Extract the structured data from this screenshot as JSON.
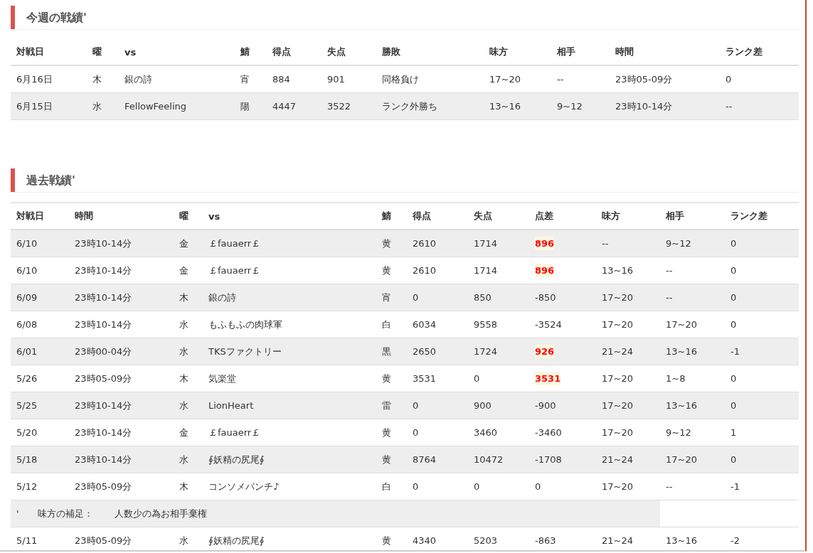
{
  "sections": [
    {
      "title": "今週の戦績'",
      "columns": [
        "対戦日",
        "曜",
        "vs",
        "鯖",
        "得点",
        "失点",
        "勝敗",
        "味方",
        "相手",
        "時間",
        "ランク差"
      ],
      "rows": [
        {
          "kind": "match",
          "cells": [
            "6月16日",
            "木",
            "銀の詩",
            "宵",
            "884",
            "901",
            "同格負け",
            "17~20",
            "--",
            "23時05-09分",
            "0"
          ]
        },
        {
          "kind": "match",
          "cells": [
            "6月15日",
            "水",
            "FellowFeeling",
            "陽",
            "4447",
            "3522",
            "ランク外勝ち",
            "13~16",
            "9~12",
            "23時10-14分",
            "--"
          ]
        }
      ]
    },
    {
      "title": "過去戦績'",
      "columns": [
        "対戦日",
        "時間",
        "曜",
        "vs",
        "鯖",
        "得点",
        "失点",
        "点差",
        "味方",
        "相手",
        "ランク差"
      ],
      "rows": [
        {
          "kind": "match",
          "highlight": true,
          "cells": [
            "6/10",
            "23時10-14分",
            "金",
            "￡fauaerr￡",
            "黄",
            "2610",
            "1714",
            "896",
            "--",
            "9~12",
            "0"
          ]
        },
        {
          "kind": "match",
          "highlight": true,
          "cells": [
            "6/10",
            "23時10-14分",
            "金",
            "￡fauaerr￡",
            "黄",
            "2610",
            "1714",
            "896",
            "13~16",
            "--",
            "0"
          ]
        },
        {
          "kind": "match",
          "highlight": false,
          "cells": [
            "6/09",
            "23時10-14分",
            "木",
            "銀の詩",
            "宵",
            "0",
            "850",
            "-850",
            "17~20",
            "--",
            "0"
          ]
        },
        {
          "kind": "match",
          "highlight": false,
          "cells": [
            "6/08",
            "23時10-14分",
            "水",
            "もふもふの肉球軍",
            "白",
            "6034",
            "9558",
            "-3524",
            "17~20",
            "17~20",
            "0"
          ]
        },
        {
          "kind": "match",
          "highlight": true,
          "cells": [
            "6/01",
            "23時00-04分",
            "水",
            "TKSファクトリー",
            "黒",
            "2650",
            "1724",
            "926",
            "21~24",
            "13~16",
            "-1"
          ]
        },
        {
          "kind": "match",
          "highlight": true,
          "cells": [
            "5/26",
            "23時05-09分",
            "木",
            "気楽堂",
            "黄",
            "3531",
            "0",
            "3531",
            "17~20",
            "1~8",
            "0"
          ]
        },
        {
          "kind": "match",
          "highlight": false,
          "cells": [
            "5/25",
            "23時10-14分",
            "水",
            "LionHeart",
            "雷",
            "0",
            "900",
            "-900",
            "17~20",
            "13~16",
            "0"
          ]
        },
        {
          "kind": "match",
          "highlight": false,
          "cells": [
            "5/20",
            "23時10-14分",
            "金",
            "￡fauaerr￡",
            "黄",
            "0",
            "3460",
            "-3460",
            "17~20",
            "9~12",
            "1"
          ]
        },
        {
          "kind": "match",
          "highlight": false,
          "cells": [
            "5/18",
            "23時10-14分",
            "水",
            "∮妖精の尻尾∮",
            "黄",
            "8764",
            "10472",
            "-1708",
            "21~24",
            "17~20",
            "0"
          ]
        },
        {
          "kind": "match",
          "highlight": false,
          "cells": [
            "5/12",
            "23時05-09分",
            "木",
            "コンソメパンチ♪",
            "白",
            "0",
            "0",
            "0",
            "17~20",
            "--",
            "-1"
          ]
        },
        {
          "kind": "note",
          "mark": "'",
          "label": "味方の補足：",
          "text": "人数少の為お相手棄権"
        },
        {
          "kind": "match",
          "highlight": false,
          "cells": [
            "5/11",
            "23時05-09分",
            "水",
            "∮妖精の尻尾∮",
            "黄",
            "4340",
            "5203",
            "-863",
            "21~24",
            "13~16",
            "-2"
          ]
        }
      ]
    }
  ]
}
